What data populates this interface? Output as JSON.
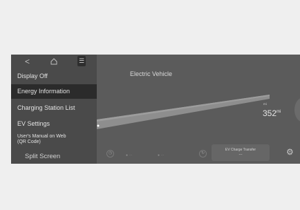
{
  "header": {
    "title": "Electric Vehicle"
  },
  "sidebar": {
    "items": [
      {
        "label": "Display Off"
      },
      {
        "label": "Energy Information"
      },
      {
        "label": "Charging Station List"
      },
      {
        "label": "EV Settings"
      },
      {
        "label": "User's Manual on Web"
      },
      {
        "label": "(QR Code)"
      },
      {
        "label": "Split Screen"
      }
    ]
  },
  "range": {
    "value": "352",
    "unit": "mi"
  },
  "bottom_bar": {
    "ev_charge_label": "EV Charge Transfer",
    "ev_charge_value": "---"
  },
  "colors": {
    "screen_bg": "#5b5b5b",
    "sidebar_bg": "#4a4a4a",
    "active_bg": "#2b2b2b"
  }
}
